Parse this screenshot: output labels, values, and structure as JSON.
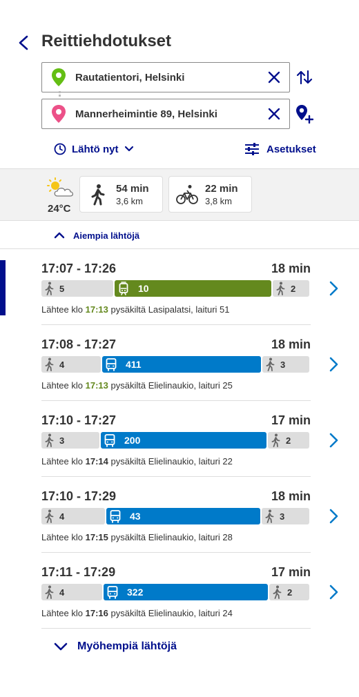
{
  "header": {
    "title": "Reittiehdotukset",
    "back_icon": "chevron-left-icon"
  },
  "from": {
    "value": "Rautatientori, Helsinki",
    "pin_color": "#64be14"
  },
  "to": {
    "value": "Mannerheimintie 89, Helsinki",
    "pin_color": "#ec5188"
  },
  "time_selector": {
    "label": "Lähtö nyt"
  },
  "settings": {
    "label": "Asetukset"
  },
  "weather": {
    "temperature": "24°C",
    "icon": "partly-sunny-icon"
  },
  "modes": [
    {
      "mode": "walk",
      "duration": "54 min",
      "distance": "3,6 km"
    },
    {
      "mode": "bicycle",
      "duration": "22 min",
      "distance": "3,8 km"
    }
  ],
  "earlier_label": "Aiempia lähtöjä",
  "later_label": "Myöhempiä lähtöjä",
  "colors": {
    "accent": "#000f8c",
    "tram": "#64891e",
    "bus": "#007ac9",
    "walk": "#dddddd"
  },
  "itineraries": [
    {
      "time": "17:07 - 17:26",
      "duration": "18 min",
      "selected": true,
      "legs": [
        {
          "type": "walk",
          "value": "5",
          "share": 0.27
        },
        {
          "type": "tram",
          "value": "10",
          "share": 0.59
        },
        {
          "type": "walk",
          "value": "2",
          "share": 0.14
        }
      ],
      "dep_prefix": "Lähtee klo",
      "dep_time": "17:13",
      "dep_realtime": true,
      "dep_suffix": "pysäkiltä Lasipalatsi, laituri 51"
    },
    {
      "time": "17:08 - 17:27",
      "duration": "18 min",
      "selected": false,
      "legs": [
        {
          "type": "walk",
          "value": "4",
          "share": 0.225
        },
        {
          "type": "bus",
          "value": "411",
          "share": 0.6
        },
        {
          "type": "walk",
          "value": "3",
          "share": 0.175
        }
      ],
      "dep_prefix": "Lähtee klo",
      "dep_time": "17:13",
      "dep_realtime": true,
      "dep_suffix": "pysäkiltä Elielinaukio, laituri 25"
    },
    {
      "time": "17:10 - 17:27",
      "duration": "17 min",
      "selected": false,
      "legs": [
        {
          "type": "walk",
          "value": "3",
          "share": 0.22
        },
        {
          "type": "bus",
          "value": "200",
          "share": 0.625
        },
        {
          "type": "walk",
          "value": "2",
          "share": 0.155
        }
      ],
      "dep_prefix": "Lähtee klo",
      "dep_time": "17:14",
      "dep_realtime": false,
      "dep_suffix": "pysäkiltä Elielinaukio, laituri 22"
    },
    {
      "time": "17:10 - 17:29",
      "duration": "18 min",
      "selected": false,
      "legs": [
        {
          "type": "walk",
          "value": "4",
          "share": 0.24
        },
        {
          "type": "bus",
          "value": "43",
          "share": 0.58
        },
        {
          "type": "walk",
          "value": "3",
          "share": 0.18
        }
      ],
      "dep_prefix": "Lähtee klo",
      "dep_time": "17:15",
      "dep_realtime": false,
      "dep_suffix": "pysäkiltä Elielinaukio, laituri 28"
    },
    {
      "time": "17:11 - 17:29",
      "duration": "17 min",
      "selected": false,
      "legs": [
        {
          "type": "walk",
          "value": "4",
          "share": 0.23
        },
        {
          "type": "bus",
          "value": "322",
          "share": 0.62
        },
        {
          "type": "walk",
          "value": "2",
          "share": 0.15
        }
      ],
      "dep_prefix": "Lähtee klo",
      "dep_time": "17:16",
      "dep_realtime": false,
      "dep_suffix": "pysäkiltä Elielinaukio, laituri 24"
    }
  ]
}
